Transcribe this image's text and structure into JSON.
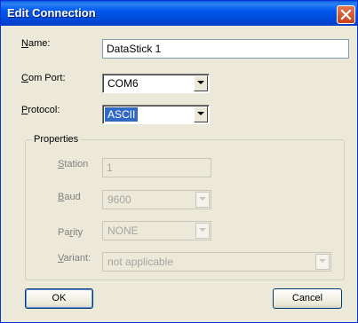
{
  "window": {
    "title": "Edit Connection"
  },
  "fields": {
    "name": {
      "label_mnemonic": "N",
      "label_rest": "ame:",
      "value": "DataStick 1"
    },
    "com_port": {
      "label_mnemonic": "C",
      "label_rest": "om Port:",
      "value": "COM6"
    },
    "protocol": {
      "label_mnemonic": "P",
      "label_rest": "rotocol:",
      "value": "ASCII"
    }
  },
  "properties": {
    "title": "Properties",
    "station": {
      "label_mnemonic": "S",
      "label_rest": "tation",
      "value": "1"
    },
    "baud": {
      "label_mnemonic": "B",
      "label_rest": "aud",
      "value": "9600"
    },
    "parity": {
      "label_pre": "Pa",
      "label_mnemonic": "r",
      "label_rest": "ity",
      "value": "NONE"
    },
    "variant": {
      "label_mnemonic": "V",
      "label_rest": "ariant:",
      "value": "not applicable"
    }
  },
  "buttons": {
    "ok": "OK",
    "cancel": "Cancel"
  },
  "colors": {
    "titlebar": "#0058ee",
    "selection": "#316ac5",
    "dialog_bg": "#ece9d8"
  }
}
